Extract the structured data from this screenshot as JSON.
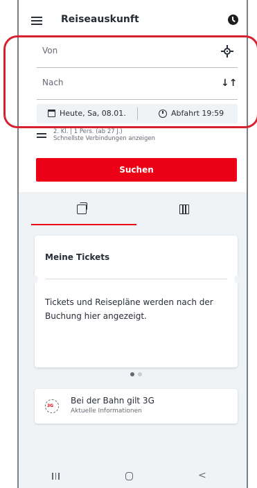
{
  "header": {
    "title": "Reiseauskunft"
  },
  "search": {
    "from_placeholder": "Von",
    "to_placeholder": "Nach",
    "date": "Heute, Sa, 08.01.",
    "time": "Abfahrt 19:59",
    "options_line1": "2. Kl. | 1 Pers. (ab 27 J.)",
    "options_line2": "Schnellste Verbindungen anzeigen",
    "search_label": "Suchen"
  },
  "card": {
    "title": "Meine Tickets",
    "text": "Tickets und Reisepläne werden nach der Buchung hier angezeigt."
  },
  "info": {
    "badge": "3G",
    "title": "Bei der Bahn gilt 3G",
    "subtitle": "Aktuelle Informationen"
  },
  "colors": {
    "accent": "#ec0016",
    "highlight": "#d6212e",
    "background": "#f0f3f5"
  }
}
